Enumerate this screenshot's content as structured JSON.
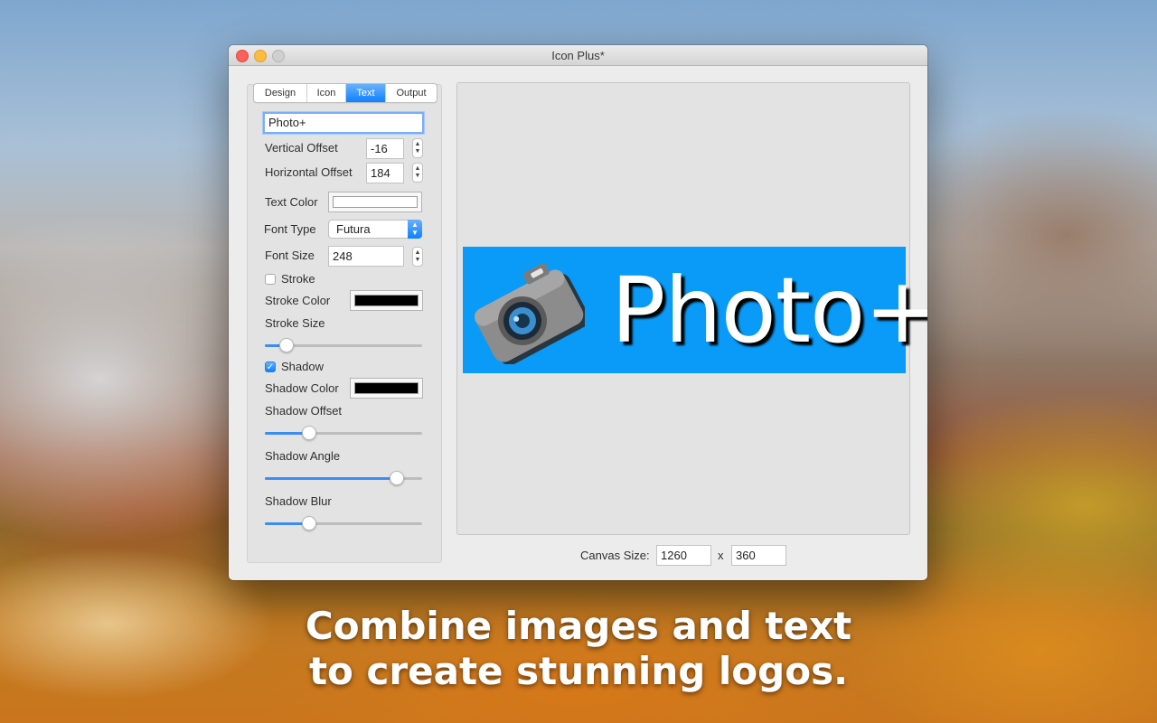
{
  "window": {
    "title": "Icon Plus*"
  },
  "tabs": [
    {
      "label": "Design",
      "active": false
    },
    {
      "label": "Icon",
      "active": false
    },
    {
      "label": "Text",
      "active": true
    },
    {
      "label": "Output",
      "active": false
    }
  ],
  "text_panel": {
    "text_value": "Photo+",
    "vertical_offset_label": "Vertical Offset",
    "vertical_offset_value": "-16",
    "horizontal_offset_label": "Horizontal Offset",
    "horizontal_offset_value": "184",
    "text_color_label": "Text Color",
    "text_color": "#ffffff",
    "font_type_label": "Font Type",
    "font_type_value": "Futura",
    "font_size_label": "Font Size",
    "font_size_value": "248",
    "stroke_label": "Stroke",
    "stroke_checked": false,
    "stroke_color_label": "Stroke Color",
    "stroke_color": "#000000",
    "stroke_size_label": "Stroke Size",
    "stroke_size_level": 0.14,
    "shadow_label": "Shadow",
    "shadow_checked": true,
    "shadow_color_label": "Shadow Color",
    "shadow_color": "#000000",
    "shadow_offset_label": "Shadow Offset",
    "shadow_offset_level": 0.28,
    "shadow_angle_label": "Shadow Angle",
    "shadow_angle_level": 0.84,
    "shadow_blur_label": "Shadow Blur",
    "shadow_blur_level": 0.28
  },
  "preview": {
    "logo_text": "Photo+",
    "logo_background": "#0a9af7",
    "icon": "camera-icon"
  },
  "canvas": {
    "size_label": "Canvas Size:",
    "width": "1260",
    "separator": "x",
    "height": "360"
  },
  "tagline": {
    "line1": "Combine images and text",
    "line2": "to create stunning logos."
  }
}
